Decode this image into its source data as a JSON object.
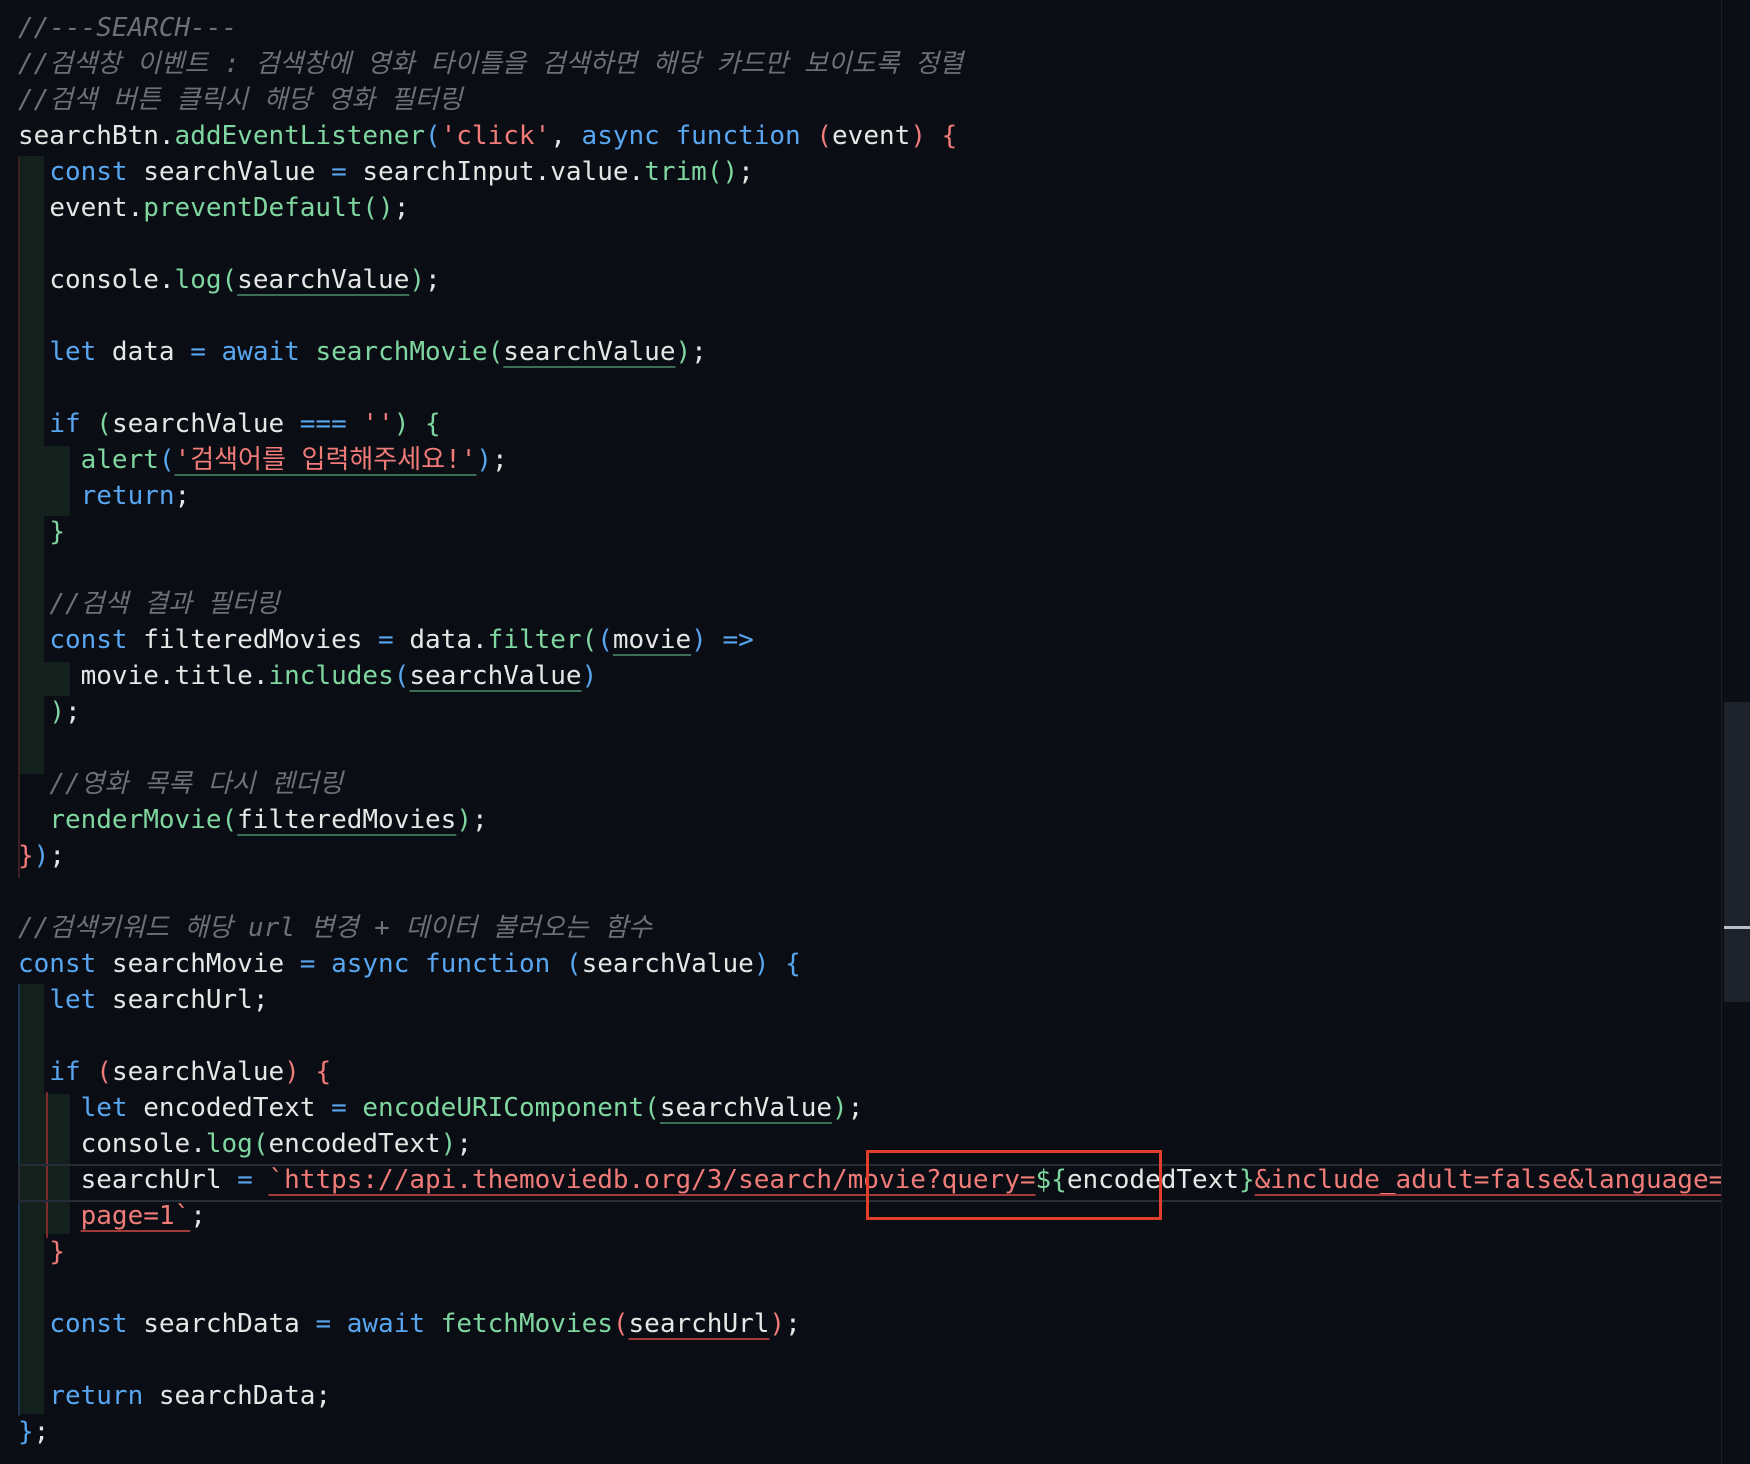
{
  "editor": {
    "lines": [
      [
        {
          "t": "//---SEARCH---",
          "c": "comment"
        }
      ],
      [
        {
          "t": "//검색창 이벤트 : 검색창에 영화 타이틀을 검색하면 해당 카드만 보이도록 정렬",
          "c": "comment"
        }
      ],
      [
        {
          "t": "//검색 버튼 클릭시 해당 영화 필터링",
          "c": "comment"
        }
      ],
      [
        {
          "t": "searchBtn",
          "c": "punc"
        },
        {
          "t": ".",
          "c": "punc"
        },
        {
          "t": "addEventListener",
          "c": "fn"
        },
        {
          "t": "(",
          "c": "brace2"
        },
        {
          "t": "'click'",
          "c": "str"
        },
        {
          "t": ", ",
          "c": "punc"
        },
        {
          "t": "async",
          "c": "kw"
        },
        {
          "t": " ",
          "c": "punc"
        },
        {
          "t": "function",
          "c": "kw"
        },
        {
          "t": " ",
          "c": "punc"
        },
        {
          "t": "(",
          "c": "brace1"
        },
        {
          "t": "event",
          "c": "param"
        },
        {
          "t": ")",
          "c": "brace1"
        },
        {
          "t": " ",
          "c": "punc"
        },
        {
          "t": "{",
          "c": "brace1"
        }
      ],
      [
        {
          "t": "  "
        },
        {
          "t": "const",
          "c": "kw"
        },
        {
          "t": " searchValue ",
          "c": "punc"
        },
        {
          "t": "=",
          "c": "kw"
        },
        {
          "t": " searchInput",
          "c": "punc"
        },
        {
          "t": ".",
          "c": "punc"
        },
        {
          "t": "value",
          "c": "punc"
        },
        {
          "t": ".",
          "c": "punc"
        },
        {
          "t": "trim",
          "c": "fn"
        },
        {
          "t": "()",
          "c": "brace3"
        },
        {
          "t": ";",
          "c": "punc"
        }
      ],
      [
        {
          "t": "  "
        },
        {
          "t": "event",
          "c": "punc"
        },
        {
          "t": ".",
          "c": "punc"
        },
        {
          "t": "preventDefault",
          "c": "fn"
        },
        {
          "t": "()",
          "c": "brace3"
        },
        {
          "t": ";",
          "c": "punc"
        }
      ],
      [],
      [
        {
          "t": "  "
        },
        {
          "t": "console",
          "c": "punc"
        },
        {
          "t": ".",
          "c": "punc"
        },
        {
          "t": "log",
          "c": "fn"
        },
        {
          "t": "(",
          "c": "brace3"
        },
        {
          "t": "searchValue",
          "c": "param ul-green"
        },
        {
          "t": ")",
          "c": "brace3"
        },
        {
          "t": ";",
          "c": "punc"
        }
      ],
      [],
      [
        {
          "t": "  "
        },
        {
          "t": "let",
          "c": "kw"
        },
        {
          "t": " data ",
          "c": "punc"
        },
        {
          "t": "=",
          "c": "kw"
        },
        {
          "t": " ",
          "c": "punc"
        },
        {
          "t": "await",
          "c": "kw"
        },
        {
          "t": " ",
          "c": "punc"
        },
        {
          "t": "searchMovie",
          "c": "fn"
        },
        {
          "t": "(",
          "c": "brace3"
        },
        {
          "t": "searchValue",
          "c": "param ul-green"
        },
        {
          "t": ")",
          "c": "brace3"
        },
        {
          "t": ";",
          "c": "punc"
        }
      ],
      [],
      [
        {
          "t": "  "
        },
        {
          "t": "if",
          "c": "kw"
        },
        {
          "t": " ",
          "c": "punc"
        },
        {
          "t": "(",
          "c": "brace3"
        },
        {
          "t": "searchValue ",
          "c": "punc"
        },
        {
          "t": "===",
          "c": "kw"
        },
        {
          "t": " ",
          "c": "punc"
        },
        {
          "t": "''",
          "c": "str"
        },
        {
          "t": ")",
          "c": "brace3"
        },
        {
          "t": " ",
          "c": "punc"
        },
        {
          "t": "{",
          "c": "brace3"
        }
      ],
      [
        {
          "t": "    "
        },
        {
          "t": "alert",
          "c": "fn"
        },
        {
          "t": "(",
          "c": "brace2"
        },
        {
          "t": "'검색어를 입력해주세요!'",
          "c": "str ul-green"
        },
        {
          "t": ")",
          "c": "brace2"
        },
        {
          "t": ";",
          "c": "punc"
        }
      ],
      [
        {
          "t": "    "
        },
        {
          "t": "return",
          "c": "kw"
        },
        {
          "t": ";",
          "c": "punc"
        }
      ],
      [
        {
          "t": "  "
        },
        {
          "t": "}",
          "c": "brace3"
        }
      ],
      [],
      [
        {
          "t": "  "
        },
        {
          "t": "//검색 결과 필터링",
          "c": "comment"
        }
      ],
      [
        {
          "t": "  "
        },
        {
          "t": "const",
          "c": "kw"
        },
        {
          "t": " filteredMovies ",
          "c": "punc"
        },
        {
          "t": "=",
          "c": "kw"
        },
        {
          "t": " data",
          "c": "punc"
        },
        {
          "t": ".",
          "c": "punc"
        },
        {
          "t": "filter",
          "c": "fn"
        },
        {
          "t": "(",
          "c": "brace3"
        },
        {
          "t": "(",
          "c": "brace2"
        },
        {
          "t": "movie",
          "c": "param ul-green"
        },
        {
          "t": ")",
          "c": "brace2"
        },
        {
          "t": " ",
          "c": "punc"
        },
        {
          "t": "=>",
          "c": "kw"
        }
      ],
      [
        {
          "t": "    "
        },
        {
          "t": "movie",
          "c": "punc"
        },
        {
          "t": ".",
          "c": "punc"
        },
        {
          "t": "title",
          "c": "punc"
        },
        {
          "t": ".",
          "c": "punc"
        },
        {
          "t": "includes",
          "c": "fn"
        },
        {
          "t": "(",
          "c": "brace2"
        },
        {
          "t": "searchValue",
          "c": "param ul-green"
        },
        {
          "t": ")",
          "c": "brace2"
        }
      ],
      [
        {
          "t": "  "
        },
        {
          "t": ")",
          "c": "brace3"
        },
        {
          "t": ";",
          "c": "punc"
        }
      ],
      [],
      [
        {
          "t": "  "
        },
        {
          "t": "//영화 목록 다시 렌더링",
          "c": "comment"
        }
      ],
      [
        {
          "t": "  "
        },
        {
          "t": "renderMovie",
          "c": "fn"
        },
        {
          "t": "(",
          "c": "brace3"
        },
        {
          "t": "filteredMovies",
          "c": "param ul-green"
        },
        {
          "t": ")",
          "c": "brace3"
        },
        {
          "t": ";",
          "c": "punc"
        }
      ],
      [
        {
          "t": "}",
          "c": "brace1"
        },
        {
          "t": ")",
          "c": "brace2"
        },
        {
          "t": ";",
          "c": "punc"
        }
      ],
      [],
      [
        {
          "t": "//검색키워드 해당 url 변경 + 데이터 불러오는 함수",
          "c": "comment"
        }
      ],
      [
        {
          "t": "const",
          "c": "kw"
        },
        {
          "t": " searchMovie ",
          "c": "punc"
        },
        {
          "t": "=",
          "c": "kw"
        },
        {
          "t": " ",
          "c": "punc"
        },
        {
          "t": "async",
          "c": "kw"
        },
        {
          "t": " ",
          "c": "punc"
        },
        {
          "t": "function",
          "c": "kw"
        },
        {
          "t": " ",
          "c": "punc"
        },
        {
          "t": "(",
          "c": "brace2"
        },
        {
          "t": "searchValue",
          "c": "param"
        },
        {
          "t": ")",
          "c": "brace2"
        },
        {
          "t": " ",
          "c": "punc"
        },
        {
          "t": "{",
          "c": "brace2"
        }
      ],
      [
        {
          "t": "  "
        },
        {
          "t": "let",
          "c": "kw"
        },
        {
          "t": " searchUrl",
          "c": "punc"
        },
        {
          "t": ";",
          "c": "punc"
        }
      ],
      [],
      [
        {
          "t": "  "
        },
        {
          "t": "if",
          "c": "kw"
        },
        {
          "t": " ",
          "c": "punc"
        },
        {
          "t": "(",
          "c": "brace1"
        },
        {
          "t": "searchValue",
          "c": "punc"
        },
        {
          "t": ")",
          "c": "brace1"
        },
        {
          "t": " ",
          "c": "punc"
        },
        {
          "t": "{",
          "c": "brace1"
        }
      ],
      [
        {
          "t": "    "
        },
        {
          "t": "let",
          "c": "kw"
        },
        {
          "t": " encodedText ",
          "c": "punc"
        },
        {
          "t": "=",
          "c": "kw"
        },
        {
          "t": " ",
          "c": "punc"
        },
        {
          "t": "encodeURIComponent",
          "c": "fn"
        },
        {
          "t": "(",
          "c": "brace3"
        },
        {
          "t": "searchValue",
          "c": "param ul-green"
        },
        {
          "t": ")",
          "c": "brace3"
        },
        {
          "t": ";",
          "c": "punc"
        }
      ],
      [
        {
          "t": "    "
        },
        {
          "t": "console",
          "c": "punc"
        },
        {
          "t": ".",
          "c": "punc"
        },
        {
          "t": "log",
          "c": "fn"
        },
        {
          "t": "(",
          "c": "brace3"
        },
        {
          "t": "encodedText",
          "c": "param"
        },
        {
          "t": ")",
          "c": "brace3"
        },
        {
          "t": ";",
          "c": "punc"
        }
      ],
      [
        {
          "t": "    "
        },
        {
          "t": "searchUrl ",
          "c": "punc"
        },
        {
          "t": "=",
          "c": "kw"
        },
        {
          "t": " ",
          "c": "punc"
        },
        {
          "t": "`https://api.themoviedb.org/3/search/movie?query=",
          "c": "str ul-red"
        },
        {
          "t": "${",
          "c": "fn"
        },
        {
          "t": "encodedText",
          "c": "param"
        },
        {
          "t": "}",
          "c": "fn"
        },
        {
          "t": "&include_adult=false&language=ko-KR&",
          "c": "str ul-red"
        }
      ],
      [
        {
          "t": "    "
        },
        {
          "t": "page=1`",
          "c": "str ul-red"
        },
        {
          "t": ";",
          "c": "punc"
        }
      ],
      [
        {
          "t": "  "
        },
        {
          "t": "}",
          "c": "brace1"
        }
      ],
      [],
      [
        {
          "t": "  "
        },
        {
          "t": "const",
          "c": "kw"
        },
        {
          "t": " searchData ",
          "c": "punc"
        },
        {
          "t": "=",
          "c": "kw"
        },
        {
          "t": " ",
          "c": "punc"
        },
        {
          "t": "await",
          "c": "kw"
        },
        {
          "t": " ",
          "c": "punc"
        },
        {
          "t": "fetchMovies",
          "c": "fn"
        },
        {
          "t": "(",
          "c": "brace1"
        },
        {
          "t": "searchUrl",
          "c": "param ul-red"
        },
        {
          "t": ")",
          "c": "brace1"
        },
        {
          "t": ";",
          "c": "punc"
        }
      ],
      [],
      [
        {
          "t": "  "
        },
        {
          "t": "return",
          "c": "kw"
        },
        {
          "t": " searchData",
          "c": "punc"
        },
        {
          "t": ";",
          "c": "punc"
        }
      ],
      [
        {
          "t": "}",
          "c": "brace2"
        },
        {
          "t": ";",
          "c": "punc"
        }
      ]
    ]
  },
  "annotation": {
    "highlighted_text": "query=${encodedText}",
    "highlight_color": "#e0402a"
  },
  "colors": {
    "background": "#0a0e14",
    "keyword": "#59a6f0",
    "function": "#7fd6a0",
    "string": "#f07b78",
    "comment": "#6b7079",
    "text": "#e6e6e6"
  }
}
